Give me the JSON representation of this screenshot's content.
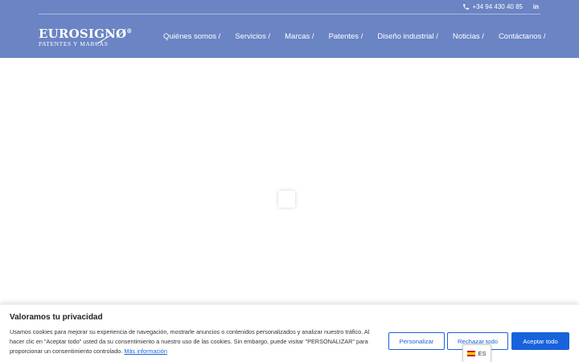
{
  "header": {
    "phone": "+34 94 430 40 85",
    "linkedin": "in",
    "logo": {
      "main": "EUROSIGNØ",
      "reg": "®",
      "sub": "PATENTES Y MARCAS"
    },
    "nav": [
      {
        "label": "Quiénes somos /"
      },
      {
        "label": "Servicios /"
      },
      {
        "label": "Marcas /"
      },
      {
        "label": "Patentes /"
      },
      {
        "label": "Diseño industrial /"
      },
      {
        "label": "Noticias /"
      },
      {
        "label": "Contáctanos /"
      }
    ]
  },
  "cookie": {
    "title": "Valoramos tu privacidad",
    "text": "Usamos cookies para mejorar su experiencia de navegación, mostrarle anuncios o contenidos personalizados y analizar nuestro tráfico. Al hacer clic en “Aceptar todo” usted da su consentimiento a nuestro uso de las cookies. Sin embargo, puede visitar \"PERSONALIZAR\" para proporcionar un consentimiento controlado.",
    "more_link": "Más información",
    "customize": "Personalizar",
    "reject": "Rechazar todo",
    "accept": "Aceptar todo"
  },
  "lang": {
    "code": "ES"
  },
  "colors": {
    "header_bg": "#6b84c4",
    "button_blue": "#1863dc"
  }
}
